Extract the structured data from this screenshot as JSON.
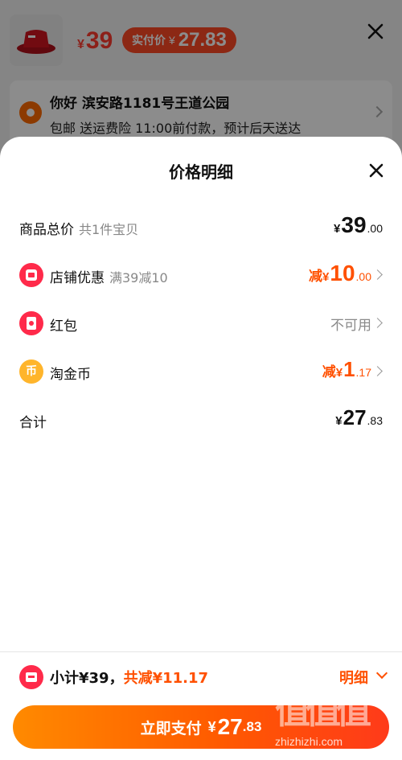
{
  "background": {
    "price_yen": "¥",
    "price": "39",
    "actual_label": "实付价",
    "actual_yen": "¥",
    "actual_price": "27.83",
    "address_title": "你好 滨安路1181号王道公园",
    "address_sub": "包邮 送运费险 11:00前付款，预计后天送达"
  },
  "sheet": {
    "title": "价格明细",
    "rows": [
      {
        "label": "商品总价",
        "sub": "共1件宝贝",
        "yen": "¥",
        "int": "39",
        "dec": ".00"
      },
      {
        "label": "店铺优惠",
        "sub": "满39减10",
        "prefix": "减",
        "yen": "¥",
        "int": "10",
        "dec": ".00",
        "icon": "store-coupon-icon"
      },
      {
        "label": "红包",
        "muted": "不可用",
        "icon": "red-packet-icon"
      },
      {
        "label": "淘金币",
        "prefix": "减",
        "yen": "¥",
        "int": "1",
        "dec": ".17",
        "icon": "coin-icon",
        "icon_glyph": "币"
      },
      {
        "label": "合计",
        "yen": "¥",
        "int": "27",
        "dec": ".83"
      }
    ]
  },
  "footer": {
    "subtotal": "小计¥39，",
    "discount": "共减¥11.17",
    "detail": "明细",
    "pay_label": "立即支付",
    "pay_yen": "¥",
    "pay_int": "27",
    "pay_dec": ".83"
  },
  "watermark": {
    "mark": "值值值",
    "url": "zhizhizhi.com"
  },
  "colors": {
    "accent": "#ff5000",
    "brand_red": "#ff2a4a",
    "button_start": "#ff8a00",
    "button_end": "#ff3a1a"
  }
}
